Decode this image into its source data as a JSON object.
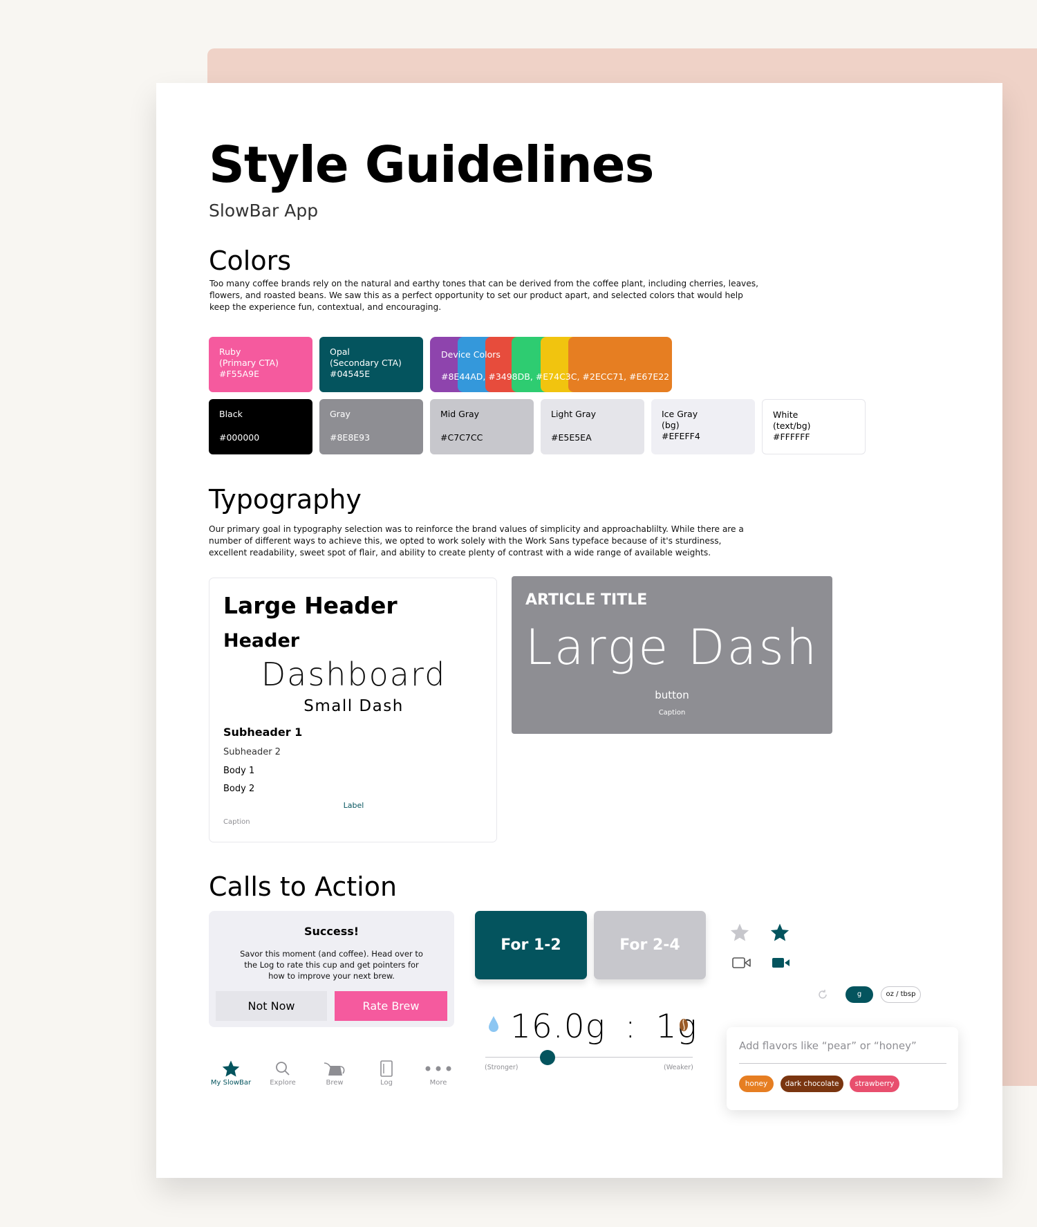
{
  "title": "Style Guidelines",
  "subtitle": "SlowBar App",
  "colors": {
    "heading": "Colors",
    "description": "Too many coffee brands rely on the natural and earthy tones that can be derived from the coffee plant, including cherries, leaves, flowers, and roasted beans. We saw this as a perfect opportunity to set our product apart, and selected colors that would help keep the experience fun, contextual, and encouraging.",
    "swatches": [
      {
        "name": "Ruby",
        "role": "(Primary CTA)",
        "code": "#F55A9E"
      },
      {
        "name": "Opal",
        "role": "(Secondary CTA)",
        "code": "#04545E"
      },
      {
        "name": "Device Colors",
        "code": "#8E44AD, #3498DB, #E74C3C, #2ECC71, #E67E22",
        "strips": [
          "#8E44AD",
          "#3498DB",
          "#E74C3C",
          "#2ECC71",
          "#F1C40F",
          "#E67E22"
        ]
      },
      {
        "name": "Black",
        "code": "#000000"
      },
      {
        "name": "Gray",
        "code": "#8E8E93"
      },
      {
        "name": "Mid Gray",
        "code": "#C7C7CC"
      },
      {
        "name": "Light Gray",
        "code": "#E5E5EA"
      },
      {
        "name": "Ice Gray",
        "role": "(bg)",
        "code": "#EFEFF4"
      },
      {
        "name": "White",
        "role": "(text/bg)",
        "code": "#FFFFFF"
      }
    ]
  },
  "typography": {
    "heading": "Typography",
    "description": "Our primary goal in typography selection was to reinforce the brand values of simplicity and approachablilty. While there are a number of different ways to achieve this, we opted to work solely with the Work Sans typeface because of it's sturdiness, excellent readability, sweet spot of flair, and ability to create plenty of contrast with a wide range of available weights.",
    "samples": {
      "large_header": "Large Header",
      "header": "Header",
      "dashboard": "Dashboard",
      "small_dash": "Small Dash",
      "subheader1": "Subheader 1",
      "subheader2": "Subheader 2",
      "body1": "Body 1",
      "body2": "Body 2",
      "label": "Label",
      "caption": "Caption"
    },
    "article": {
      "title": "ARTICLE TITLE",
      "large_dash": "Large Dash",
      "button": "button",
      "caption": "Caption"
    }
  },
  "cta": {
    "heading": "Calls to Action",
    "dialog": {
      "title": "Success!",
      "message": "Savor this moment (and coffee). Head over to the Log to rate this cup and get pointers for how to improve your next brew.",
      "secondary": "Not Now",
      "primary": "Rate Brew"
    },
    "servings": [
      "For 1-2",
      "For 2-4"
    ],
    "ratio": {
      "water": "16.0g",
      "separator": ":",
      "coffee": "1g",
      "min_label": "(Stronger)",
      "max_label": "(Weaker)",
      "level": 0.3
    },
    "units": [
      "g",
      "oz / tbsp"
    ],
    "flavor": {
      "placeholder": "Add flavors like “pear” or “honey”",
      "tags": [
        {
          "label": "honey",
          "color": "#E67E22"
        },
        {
          "label": "dark chocolate",
          "color": "#7A3510"
        },
        {
          "label": "strawberry",
          "color": "#E84F6E"
        }
      ]
    },
    "nav": [
      "My SlowBar",
      "Explore",
      "Brew",
      "Log",
      "More"
    ]
  },
  "palette": {
    "ruby": "#F55A9E",
    "opal": "#04545E",
    "gray": "#8E8E93",
    "mid_gray": "#C7C7CC",
    "light_gray": "#E5E5EA",
    "ice_gray": "#EFEFF4"
  }
}
